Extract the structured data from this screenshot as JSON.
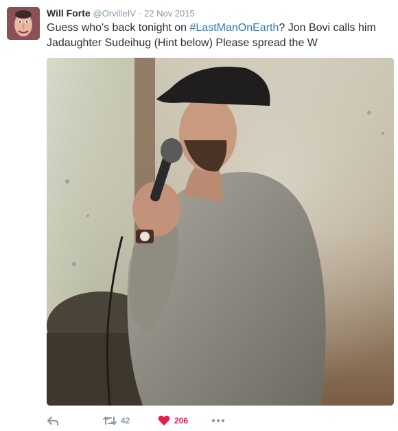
{
  "tweet": {
    "author": {
      "name": "Will Forte",
      "handle": "@OrvilleIV",
      "avatar_icon": "profile-avatar"
    },
    "separator": "·",
    "timestamp": "22 Nov 2015",
    "text_before": "Guess who's back tonight on ",
    "hashtag": "#LastManOnEarth",
    "text_after": "? Jon Bovi calls him Jadaughter Sudeihug (Hint below) Please spread the W",
    "media": {
      "type": "photo",
      "icon": "photo-image"
    },
    "actions": {
      "reply_icon": "reply-icon",
      "retweet_icon": "retweet-icon",
      "retweet_count": "42",
      "like_icon": "heart-icon",
      "like_count": "206",
      "more_icon": "more-icon"
    },
    "colors": {
      "link": "#2b7bb9",
      "muted": "#8899a6",
      "like": "#e81c4f",
      "text": "#292f33"
    }
  }
}
